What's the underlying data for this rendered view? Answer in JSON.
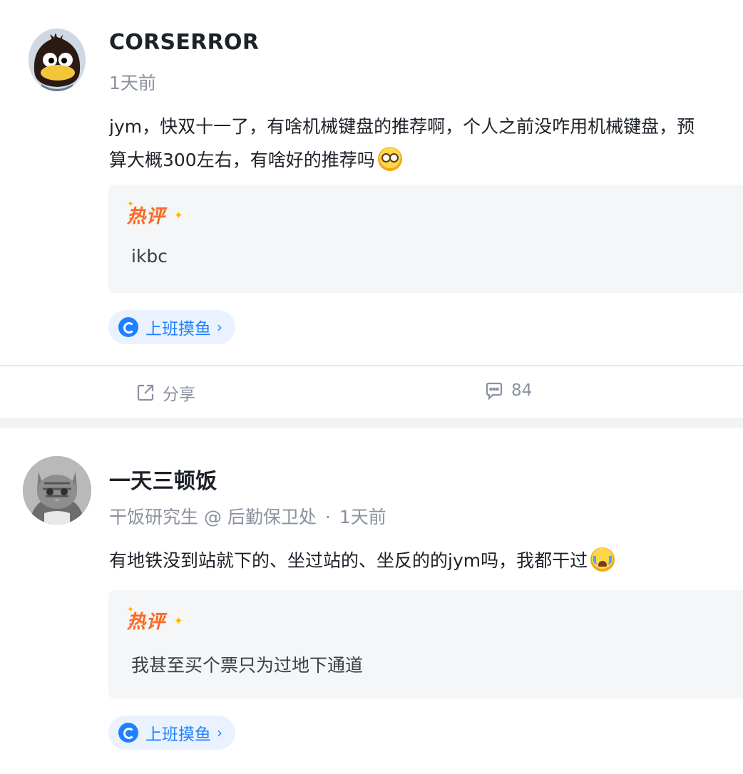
{
  "posts": [
    {
      "author": "CORSERROR",
      "meta": "1天前",
      "content_lines": [
        "jym，快双十一了，有啥机械键盘的推荐啊，个人之前没咋用机械键盘，预",
        "算大概300左右，有啥好的推荐吗"
      ],
      "content_emoji": "drooling-face-emoji",
      "hot_comment_label": "热评",
      "hot_comment": "ikbc",
      "circle": "上班摸鱼",
      "actions": {
        "share": "分享",
        "comment_count": "84"
      }
    },
    {
      "author": "一天三顿饭",
      "meta_title": "干饭研究生 @ 后勤保卫处",
      "meta_sep": "·",
      "meta": "1天前",
      "content_lines": [
        "有地铁没到站就下的、坐过站的、坐反的的jym吗，我都干过"
      ],
      "content_emoji": "crying-face-emoji",
      "hot_comment_label": "热评",
      "hot_comment": "我甚至买个票只为过地下通道",
      "circle": "上班摸鱼"
    }
  ],
  "colors": {
    "accent": "#1e80ff",
    "accent_bg": "#eaf2ff",
    "meta_text": "#8a919f",
    "hot_label": "#f76a2c",
    "page_bg": "#f2f3f5"
  }
}
